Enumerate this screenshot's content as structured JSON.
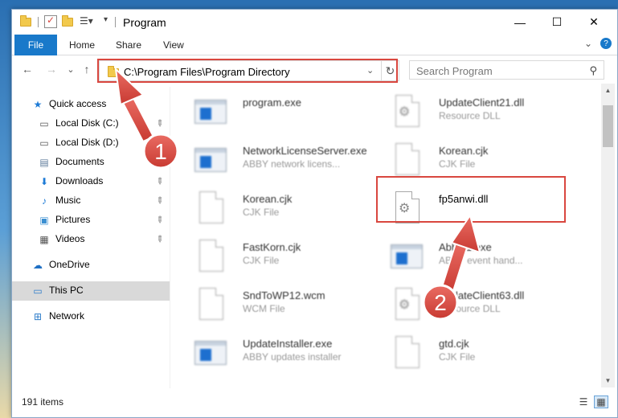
{
  "window": {
    "title": "Program",
    "controls": {
      "minimize": "—",
      "maximize": "☐",
      "close": "✕"
    }
  },
  "ribbon": {
    "tabs": [
      "File",
      "Home",
      "Share",
      "View"
    ],
    "collapse_glyph": "⌄",
    "help_glyph": "?"
  },
  "nav": {
    "back": "←",
    "forward": "→",
    "recent": "⌄",
    "up": "↑"
  },
  "address": {
    "path": "C:\\Program Files\\Program Directory",
    "dropdown_glyph": "⌄",
    "refresh_glyph": "↻"
  },
  "search": {
    "placeholder": "Search Program",
    "icon_glyph": "⚲"
  },
  "sidebar": {
    "items": [
      {
        "label": "Quick access",
        "icon": "star-icon",
        "glyph": "★",
        "color": "#1e7bd6",
        "pinned": false
      },
      {
        "label": "Local Disk (C:)",
        "icon": "drive-icon",
        "glyph": "▭",
        "color": "#555555",
        "pinned": true
      },
      {
        "label": "Local Disk (D:)",
        "icon": "drive-icon",
        "glyph": "▭",
        "color": "#555555",
        "pinned": true
      },
      {
        "label": "Documents",
        "icon": "documents-icon",
        "glyph": "▤",
        "color": "#5f7c9b",
        "pinned": true
      },
      {
        "label": "Downloads",
        "icon": "downloads-icon",
        "glyph": "⬇",
        "color": "#1e7bd6",
        "pinned": true
      },
      {
        "label": "Music",
        "icon": "music-icon",
        "glyph": "♪",
        "color": "#1e7bd6",
        "pinned": true
      },
      {
        "label": "Pictures",
        "icon": "pictures-icon",
        "glyph": "▣",
        "color": "#3b8fd1",
        "pinned": true
      },
      {
        "label": "Videos",
        "icon": "videos-icon",
        "glyph": "▦",
        "color": "#555555",
        "pinned": true
      },
      {
        "label": "OneDrive",
        "icon": "cloud-icon",
        "glyph": "☁",
        "color": "#1e6fc4",
        "pinned": false
      },
      {
        "label": "This PC",
        "icon": "computer-icon",
        "glyph": "▭",
        "color": "#2b7bc9",
        "pinned": false,
        "selected": true
      },
      {
        "label": "Network",
        "icon": "network-icon",
        "glyph": "⊞",
        "color": "#2b7bc9",
        "pinned": false
      }
    ],
    "pin_glyph": "📌"
  },
  "files": [
    {
      "name": "program.exe",
      "desc": "",
      "type": "installer"
    },
    {
      "name": "UpdateClient21.dll",
      "desc": "Resource DLL",
      "type": "dll"
    },
    {
      "name": "NetworkLicenseServer.exe",
      "desc": "ABBY network licens...",
      "type": "exe"
    },
    {
      "name": "Korean.cjk",
      "desc": "CJK File",
      "type": "doc"
    },
    {
      "name": "Korean.cjk",
      "desc": "CJK File",
      "type": "doc"
    },
    {
      "name": "fp5anwi.dll",
      "desc": "",
      "type": "dll",
      "focus": true
    },
    {
      "name": "FastKorn.cjk",
      "desc": "CJK File",
      "type": "doc"
    },
    {
      "name": "Abb...1.exe",
      "desc": "ABBY event hand...",
      "type": "exe"
    },
    {
      "name": "SndToWP12.wcm",
      "desc": "WCM File",
      "type": "doc"
    },
    {
      "name": "UpdateClient63.dll",
      "desc": "Resource DLL",
      "type": "dll"
    },
    {
      "name": "UpdateInstaller.exe",
      "desc": "ABBY updates installer",
      "type": "exe"
    },
    {
      "name": "gtd.cjk",
      "desc": "CJK File",
      "type": "doc"
    }
  ],
  "status": {
    "item_count": "191 items"
  },
  "annotations": {
    "step1": "1",
    "step2": "2",
    "highlight_color": "#d9473f"
  }
}
